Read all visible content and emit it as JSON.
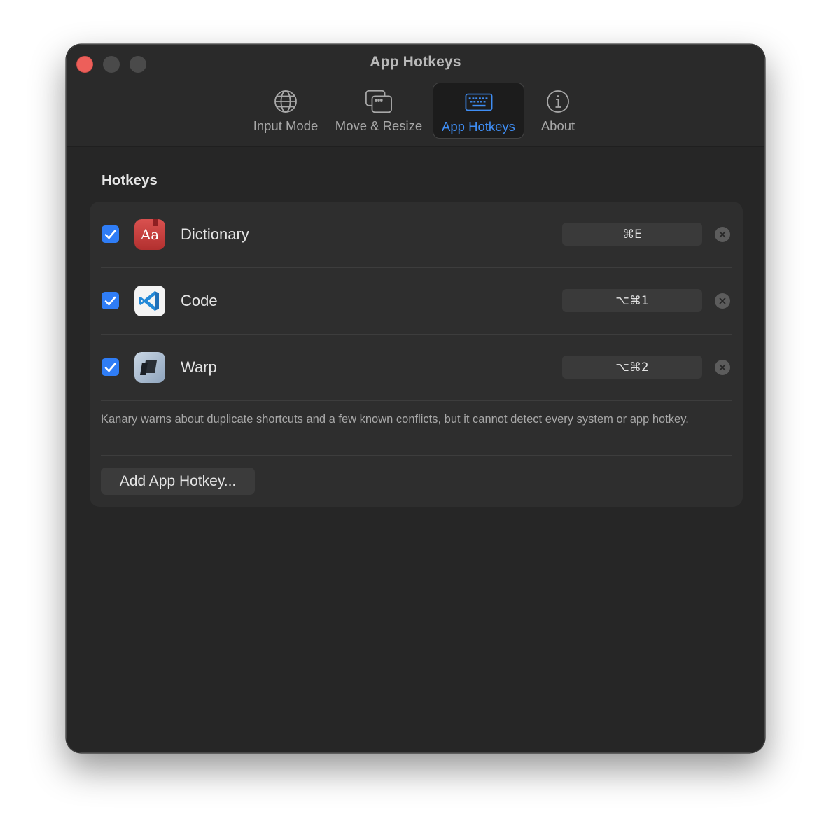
{
  "window": {
    "title": "App Hotkeys"
  },
  "tabs": [
    {
      "label": "Input Mode",
      "icon": "globe-icon"
    },
    {
      "label": "Move & Resize",
      "icon": "windows-icon"
    },
    {
      "label": "App Hotkeys",
      "icon": "keyboard-icon",
      "active": true
    },
    {
      "label": "About",
      "icon": "info-icon"
    }
  ],
  "section": {
    "title": "Hotkeys"
  },
  "hotkeys": [
    {
      "app": "Dictionary",
      "enabled": true,
      "shortcut": "⌘E",
      "icon": "dictionary-app-icon"
    },
    {
      "app": "Code",
      "enabled": true,
      "shortcut": "⌥⌘1",
      "icon": "vscode-app-icon"
    },
    {
      "app": "Warp",
      "enabled": true,
      "shortcut": "⌥⌘2",
      "icon": "warp-app-icon"
    }
  ],
  "note": "Kanary warns about duplicate shortcuts and a few known conflicts, but it cannot detect every system or app hotkey.",
  "add_button": "Add App Hotkey...",
  "colors": {
    "accent": "#3f8ef5",
    "checkbox": "#2f7df6",
    "close": "#ed5f5a"
  }
}
